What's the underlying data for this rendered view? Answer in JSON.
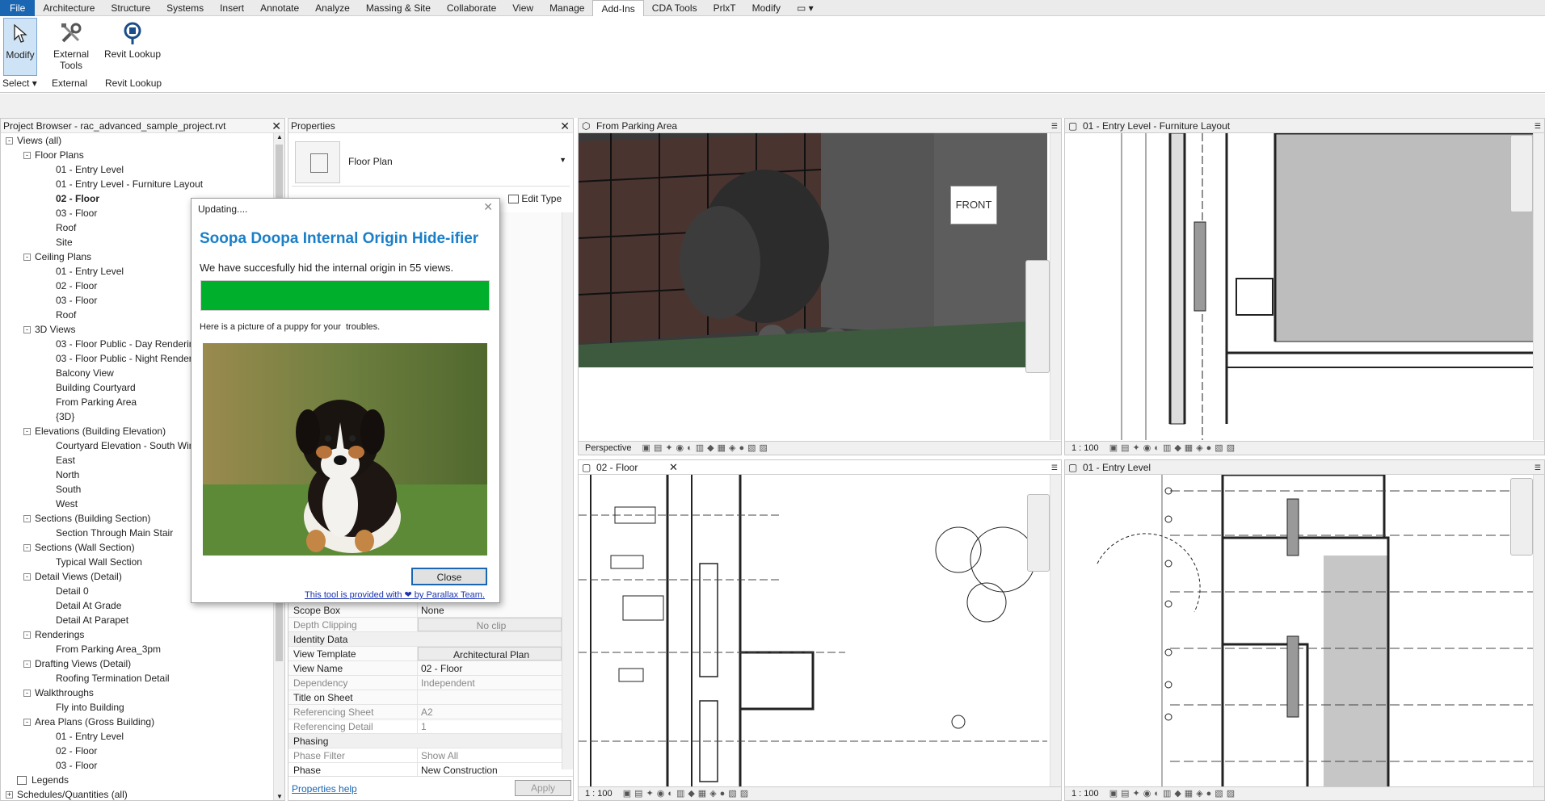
{
  "menubar": {
    "items": [
      "File",
      "Architecture",
      "Structure",
      "Systems",
      "Insert",
      "Annotate",
      "Analyze",
      "Massing & Site",
      "Collaborate",
      "View",
      "Manage",
      "Add-Ins",
      "CDA Tools",
      "PrlxT",
      "Modify"
    ],
    "active": "Add-Ins"
  },
  "ribbon": {
    "modify_label": "Modify",
    "external_tools_label": "External Tools",
    "revit_lookup_label": "Revit Lookup",
    "groups": {
      "select": "Select",
      "external": "External",
      "revit_lookup": "Revit Lookup"
    }
  },
  "project_browser": {
    "title": "Project Browser - rac_advanced_sample_project.rvt",
    "rows": [
      {
        "level": 0,
        "toggle": "-",
        "label": "Views (all)",
        "bold": false
      },
      {
        "level": 1,
        "toggle": "-",
        "label": "Floor Plans",
        "bold": false
      },
      {
        "level": 2,
        "toggle": "",
        "label": "01 - Entry Level",
        "bold": false
      },
      {
        "level": 2,
        "toggle": "",
        "label": "01 - Entry Level - Furniture Layout",
        "bold": false
      },
      {
        "level": 2,
        "toggle": "",
        "label": "02 - Floor",
        "bold": true
      },
      {
        "level": 2,
        "toggle": "",
        "label": "03 - Floor",
        "bold": false
      },
      {
        "level": 2,
        "toggle": "",
        "label": "Roof",
        "bold": false
      },
      {
        "level": 2,
        "toggle": "",
        "label": "Site",
        "bold": false
      },
      {
        "level": 1,
        "toggle": "-",
        "label": "Ceiling Plans",
        "bold": false
      },
      {
        "level": 2,
        "toggle": "",
        "label": "01 - Entry Level",
        "bold": false
      },
      {
        "level": 2,
        "toggle": "",
        "label": "02 - Floor",
        "bold": false
      },
      {
        "level": 2,
        "toggle": "",
        "label": "03 - Floor",
        "bold": false
      },
      {
        "level": 2,
        "toggle": "",
        "label": "Roof",
        "bold": false
      },
      {
        "level": 1,
        "toggle": "-",
        "label": "3D Views",
        "bold": false
      },
      {
        "level": 2,
        "toggle": "",
        "label": "03 - Floor Public - Day Rendering",
        "bold": false
      },
      {
        "level": 2,
        "toggle": "",
        "label": "03 - Floor Public - Night Rendering",
        "bold": false
      },
      {
        "level": 2,
        "toggle": "",
        "label": "Balcony View",
        "bold": false
      },
      {
        "level": 2,
        "toggle": "",
        "label": "Building Courtyard",
        "bold": false
      },
      {
        "level": 2,
        "toggle": "",
        "label": "From Parking Area",
        "bold": false
      },
      {
        "level": 2,
        "toggle": "",
        "label": "{3D}",
        "bold": false
      },
      {
        "level": 1,
        "toggle": "-",
        "label": "Elevations (Building Elevation)",
        "bold": false
      },
      {
        "level": 2,
        "toggle": "",
        "label": "Courtyard Elevation - South Wing",
        "bold": false
      },
      {
        "level": 2,
        "toggle": "",
        "label": "East",
        "bold": false
      },
      {
        "level": 2,
        "toggle": "",
        "label": "North",
        "bold": false
      },
      {
        "level": 2,
        "toggle": "",
        "label": "South",
        "bold": false
      },
      {
        "level": 2,
        "toggle": "",
        "label": "West",
        "bold": false
      },
      {
        "level": 1,
        "toggle": "-",
        "label": "Sections (Building Section)",
        "bold": false
      },
      {
        "level": 2,
        "toggle": "",
        "label": "Section Through Main Stair",
        "bold": false
      },
      {
        "level": 1,
        "toggle": "-",
        "label": "Sections (Wall Section)",
        "bold": false
      },
      {
        "level": 2,
        "toggle": "",
        "label": "Typical Wall Section",
        "bold": false
      },
      {
        "level": 1,
        "toggle": "-",
        "label": "Detail Views (Detail)",
        "bold": false
      },
      {
        "level": 2,
        "toggle": "",
        "label": "Detail 0",
        "bold": false
      },
      {
        "level": 2,
        "toggle": "",
        "label": "Detail At Grade",
        "bold": false
      },
      {
        "level": 2,
        "toggle": "",
        "label": "Detail At Parapet",
        "bold": false
      },
      {
        "level": 1,
        "toggle": "-",
        "label": "Renderings",
        "bold": false
      },
      {
        "level": 2,
        "toggle": "",
        "label": "From Parking Area_3pm",
        "bold": false
      },
      {
        "level": 1,
        "toggle": "-",
        "label": "Drafting Views (Detail)",
        "bold": false
      },
      {
        "level": 2,
        "toggle": "",
        "label": "Roofing Termination Detail",
        "bold": false
      },
      {
        "level": 1,
        "toggle": "-",
        "label": "Walkthroughs",
        "bold": false
      },
      {
        "level": 2,
        "toggle": "",
        "label": "Fly into Building",
        "bold": false
      },
      {
        "level": 1,
        "toggle": "-",
        "label": "Area Plans (Gross Building)",
        "bold": false
      },
      {
        "level": 2,
        "toggle": "",
        "label": "01 - Entry Level",
        "bold": false
      },
      {
        "level": 2,
        "toggle": "",
        "label": "02 - Floor",
        "bold": false
      },
      {
        "level": 2,
        "toggle": "",
        "label": "03 - Floor",
        "bold": false
      },
      {
        "level": 0,
        "toggle": "",
        "label": "Legends",
        "bold": false
      },
      {
        "level": 0,
        "toggle": "+",
        "label": "Schedules/Quantities (all)",
        "bold": false
      }
    ]
  },
  "properties": {
    "title": "Properties",
    "type_name": "Floor Plan",
    "edit_type": "Edit Type",
    "rows": [
      {
        "kind": "row",
        "k": "Scope Box",
        "v": "None",
        "dim": false
      },
      {
        "kind": "row",
        "k": "Depth Clipping",
        "v": "No clip",
        "dim": true
      },
      {
        "kind": "sec",
        "k": "Identity Data",
        "v": ""
      },
      {
        "kind": "row",
        "k": "View Template",
        "v": "Architectural Plan",
        "dim": false
      },
      {
        "kind": "row",
        "k": "View Name",
        "v": "02 - Floor",
        "dim": false
      },
      {
        "kind": "row",
        "k": "Dependency",
        "v": "Independent",
        "dim": true
      },
      {
        "kind": "row",
        "k": "Title on Sheet",
        "v": "",
        "dim": false
      },
      {
        "kind": "row",
        "k": "Referencing Sheet",
        "v": "A2",
        "dim": true
      },
      {
        "kind": "row",
        "k": "Referencing Detail",
        "v": "1",
        "dim": true
      },
      {
        "kind": "sec",
        "k": "Phasing",
        "v": ""
      },
      {
        "kind": "row",
        "k": "Phase Filter",
        "v": "Show All",
        "dim": true
      },
      {
        "kind": "row",
        "k": "Phase",
        "v": "New Construction",
        "dim": false
      }
    ],
    "help_link": "Properties help",
    "apply": "Apply"
  },
  "views": {
    "v1": {
      "title": "From Parking Area",
      "ctrl": "Perspective",
      "cube_label": "FRONT"
    },
    "v2": {
      "title": "01 - Entry Level - Furniture Layout",
      "ctrl": "1 : 100"
    },
    "v3": {
      "title": "02 - Floor",
      "ctrl": "1 : 100"
    },
    "v4": {
      "title": "01 - Entry Level",
      "ctrl": "1 : 100"
    }
  },
  "dialog": {
    "title": "Updating....",
    "heading": "Soopa Doopa Internal Origin Hide-ifier",
    "message": "We have succesfully hid the internal origin in 55 views.",
    "progress": 1.0,
    "progress_color": "#00b02c",
    "puppy_text": "Here is a picture of a puppy for your  troubles.",
    "close": "Close",
    "footer": "This tool is provided with ❤ by Parallax Team."
  },
  "colors": {
    "accent": "#1a66b3",
    "dialog_heading": "#1a7fc9"
  }
}
